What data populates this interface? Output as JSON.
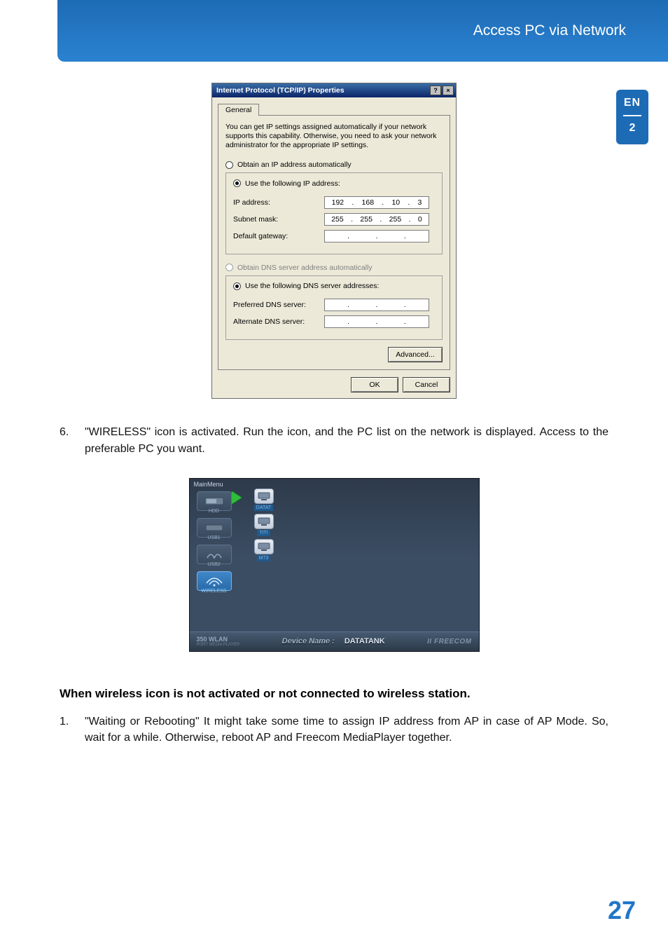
{
  "header": {
    "title": "Access PC via Network"
  },
  "sidetab": {
    "lang": "EN",
    "section": "2"
  },
  "page_number": "27",
  "win": {
    "title": "Internet Protocol (TCP/IP) Properties",
    "help_btn": "?",
    "close_btn": "×",
    "tab_general": "General",
    "desc": "You can get IP settings assigned automatically if your network supports this capability. Otherwise, you need to ask your network administrator for the appropriate IP settings.",
    "radio_obtain_ip": "Obtain an IP address automatically",
    "radio_use_ip": "Use the following IP address:",
    "lbl_ip": "IP address:",
    "ip": [
      "192",
      "168",
      "10",
      "3"
    ],
    "lbl_subnet": "Subnet mask:",
    "subnet": [
      "255",
      "255",
      "255",
      "0"
    ],
    "lbl_gateway": "Default gateway:",
    "gateway": [
      "",
      "",
      "",
      ""
    ],
    "radio_obtain_dns": "Obtain DNS server address automatically",
    "radio_use_dns": "Use the following DNS server addresses:",
    "lbl_pref_dns": "Preferred DNS server:",
    "pref_dns": [
      "",
      "",
      "",
      ""
    ],
    "lbl_alt_dns": "Alternate DNS server:",
    "alt_dns": [
      "",
      "",
      "",
      ""
    ],
    "btn_advanced": "Advanced...",
    "btn_ok": "OK",
    "btn_cancel": "Cancel"
  },
  "para6": {
    "num": "6.",
    "text": "\"WIRELESS\" icon is activated. Run the icon, and the PC list on the network is displayed. Access to the preferable PC you want."
  },
  "player": {
    "main_menu_label": "MainMenu",
    "left_items": [
      "HDD",
      "USB1",
      "USB2",
      "WIRELESS"
    ],
    "mid_items": [
      "DATAT",
      "TITI",
      "M73"
    ],
    "bottom": {
      "model": "350 WLAN",
      "sub": "PORT MEDIA PLAYER",
      "device_label": "Device Name :",
      "device_value": "DATATANK",
      "brand": "II FREECOM"
    }
  },
  "section2": {
    "heading": "When wireless icon is not activated or not connected to wireless station.",
    "list1_num": "1.",
    "list1_text": "\"Waiting or Rebooting\" It might take some time to assign IP address from AP in case of AP Mode. So, wait for a while. Otherwise, reboot AP and Freecom MediaPlayer together."
  }
}
